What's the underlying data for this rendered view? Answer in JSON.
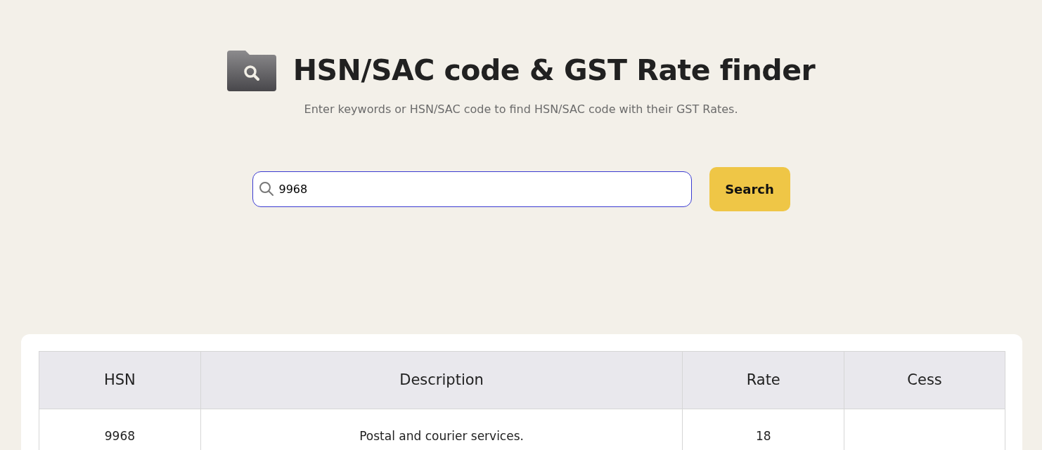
{
  "header": {
    "title": "HSN/SAC code & GST Rate finder",
    "subtitle": "Enter keywords or HSN/SAC code to find HSN/SAC code with their GST Rates."
  },
  "search": {
    "value": "9968",
    "button": "Search"
  },
  "table": {
    "columns": [
      "HSN",
      "Description",
      "Rate",
      "Cess"
    ],
    "rows": [
      {
        "hsn": "9968",
        "description": "Postal and courier services.",
        "rate": "18"
      }
    ]
  }
}
